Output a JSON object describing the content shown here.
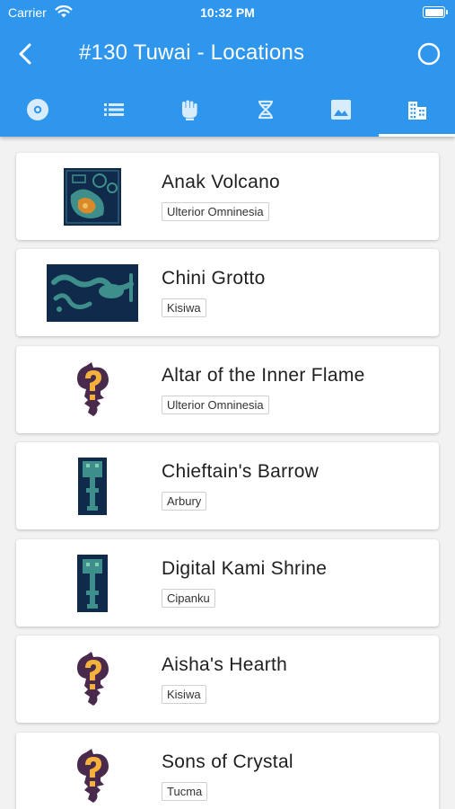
{
  "status_bar": {
    "carrier": "Carrier",
    "time": "10:32 PM",
    "wifi_icon": "wifi-icon",
    "battery_icon": "battery-icon"
  },
  "header": {
    "title": "#130 Tuwai - Locations",
    "back_icon": "chevron-left-icon",
    "action_icon": "circle-icon"
  },
  "tabs": [
    {
      "icon": "disc-icon",
      "selected": false
    },
    {
      "icon": "list-icon",
      "selected": false
    },
    {
      "icon": "fist-icon",
      "selected": false
    },
    {
      "icon": "dna-icon",
      "selected": false
    },
    {
      "icon": "image-icon",
      "selected": false
    },
    {
      "icon": "building-icon",
      "selected": true
    }
  ],
  "locations": [
    {
      "name": "Anak Volcano",
      "region": "Ulterior Omninesia",
      "thumb": "map-volcano"
    },
    {
      "name": "Chini Grotto",
      "region": "Kisiwa",
      "thumb": "map-grotto"
    },
    {
      "name": "Altar of the Inner Flame",
      "region": "Ulterior Omninesia",
      "thumb": "unknown-question-icon"
    },
    {
      "name": "Chieftain's Barrow",
      "region": "Arbury",
      "thumb": "map-barrow"
    },
    {
      "name": "Digital Kami Shrine",
      "region": "Cipanku",
      "thumb": "map-shrine"
    },
    {
      "name": "Aisha's Hearth",
      "region": "Kisiwa",
      "thumb": "unknown-question-icon"
    },
    {
      "name": "Sons of Crystal",
      "region": "Tucma",
      "thumb": "unknown-question-icon"
    }
  ],
  "colors": {
    "app_bar": "#2f96ee",
    "background": "#f2f2f2",
    "question_gold": "#f4b13c",
    "question_purple": "#4a2a4c",
    "map_bg": "#0f2a4a",
    "map_teal": "#3e8f8c"
  }
}
